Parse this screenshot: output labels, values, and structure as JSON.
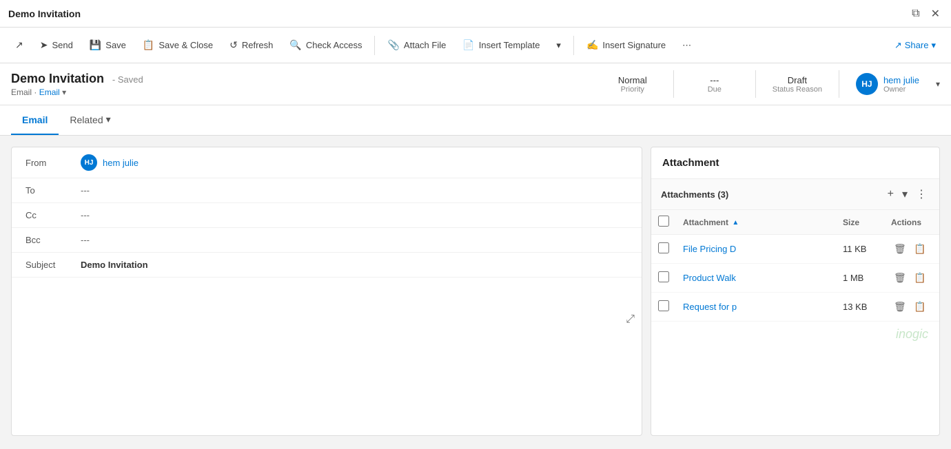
{
  "titleBar": {
    "title": "Demo Invitation",
    "restoreIcon": "⧉",
    "closeIcon": "✕"
  },
  "toolbar": {
    "sendLabel": "Send",
    "saveLabel": "Save",
    "saveCloseLabel": "Save & Close",
    "refreshLabel": "Refresh",
    "checkAccessLabel": "Check Access",
    "attachFileLabel": "Attach File",
    "insertTemplateLabel": "Insert Template",
    "insertSignatureLabel": "Insert Signature",
    "shareLabel": "Share",
    "moreIcon": "⋯"
  },
  "recordHeader": {
    "title": "Demo Invitation",
    "savedStatus": "- Saved",
    "entity": "Email",
    "entityType": "Email",
    "priority": "Normal",
    "priorityLabel": "Priority",
    "due": "---",
    "dueLabel": "Due",
    "statusReason": "Draft",
    "statusReasonLabel": "Status Reason",
    "ownerInitials": "HJ",
    "ownerName": "hem julie",
    "ownerLabel": "Owner"
  },
  "tabs": [
    {
      "id": "email",
      "label": "Email",
      "active": true
    },
    {
      "id": "related",
      "label": "Related",
      "active": false,
      "hasDropdown": true
    }
  ],
  "emailForm": {
    "fromLabel": "From",
    "fromInitials": "HJ",
    "fromName": "hem julie",
    "toLabel": "To",
    "toValue": "---",
    "ccLabel": "Cc",
    "ccValue": "---",
    "bccLabel": "Bcc",
    "bccValue": "---",
    "subjectLabel": "Subject",
    "subjectValue": "Demo Invitation"
  },
  "attachmentPanel": {
    "title": "Attachment",
    "subheaderTitle": "Attachments (3)",
    "columns": {
      "attachment": "Attachment",
      "size": "Size",
      "actions": "Actions"
    },
    "items": [
      {
        "id": 1,
        "name": "File Pricing D",
        "size": "11 KB"
      },
      {
        "id": 2,
        "name": "Product Walk",
        "size": "1 MB"
      },
      {
        "id": 3,
        "name": "Request for p",
        "size": "13 KB"
      }
    ],
    "watermark": "inogic"
  }
}
